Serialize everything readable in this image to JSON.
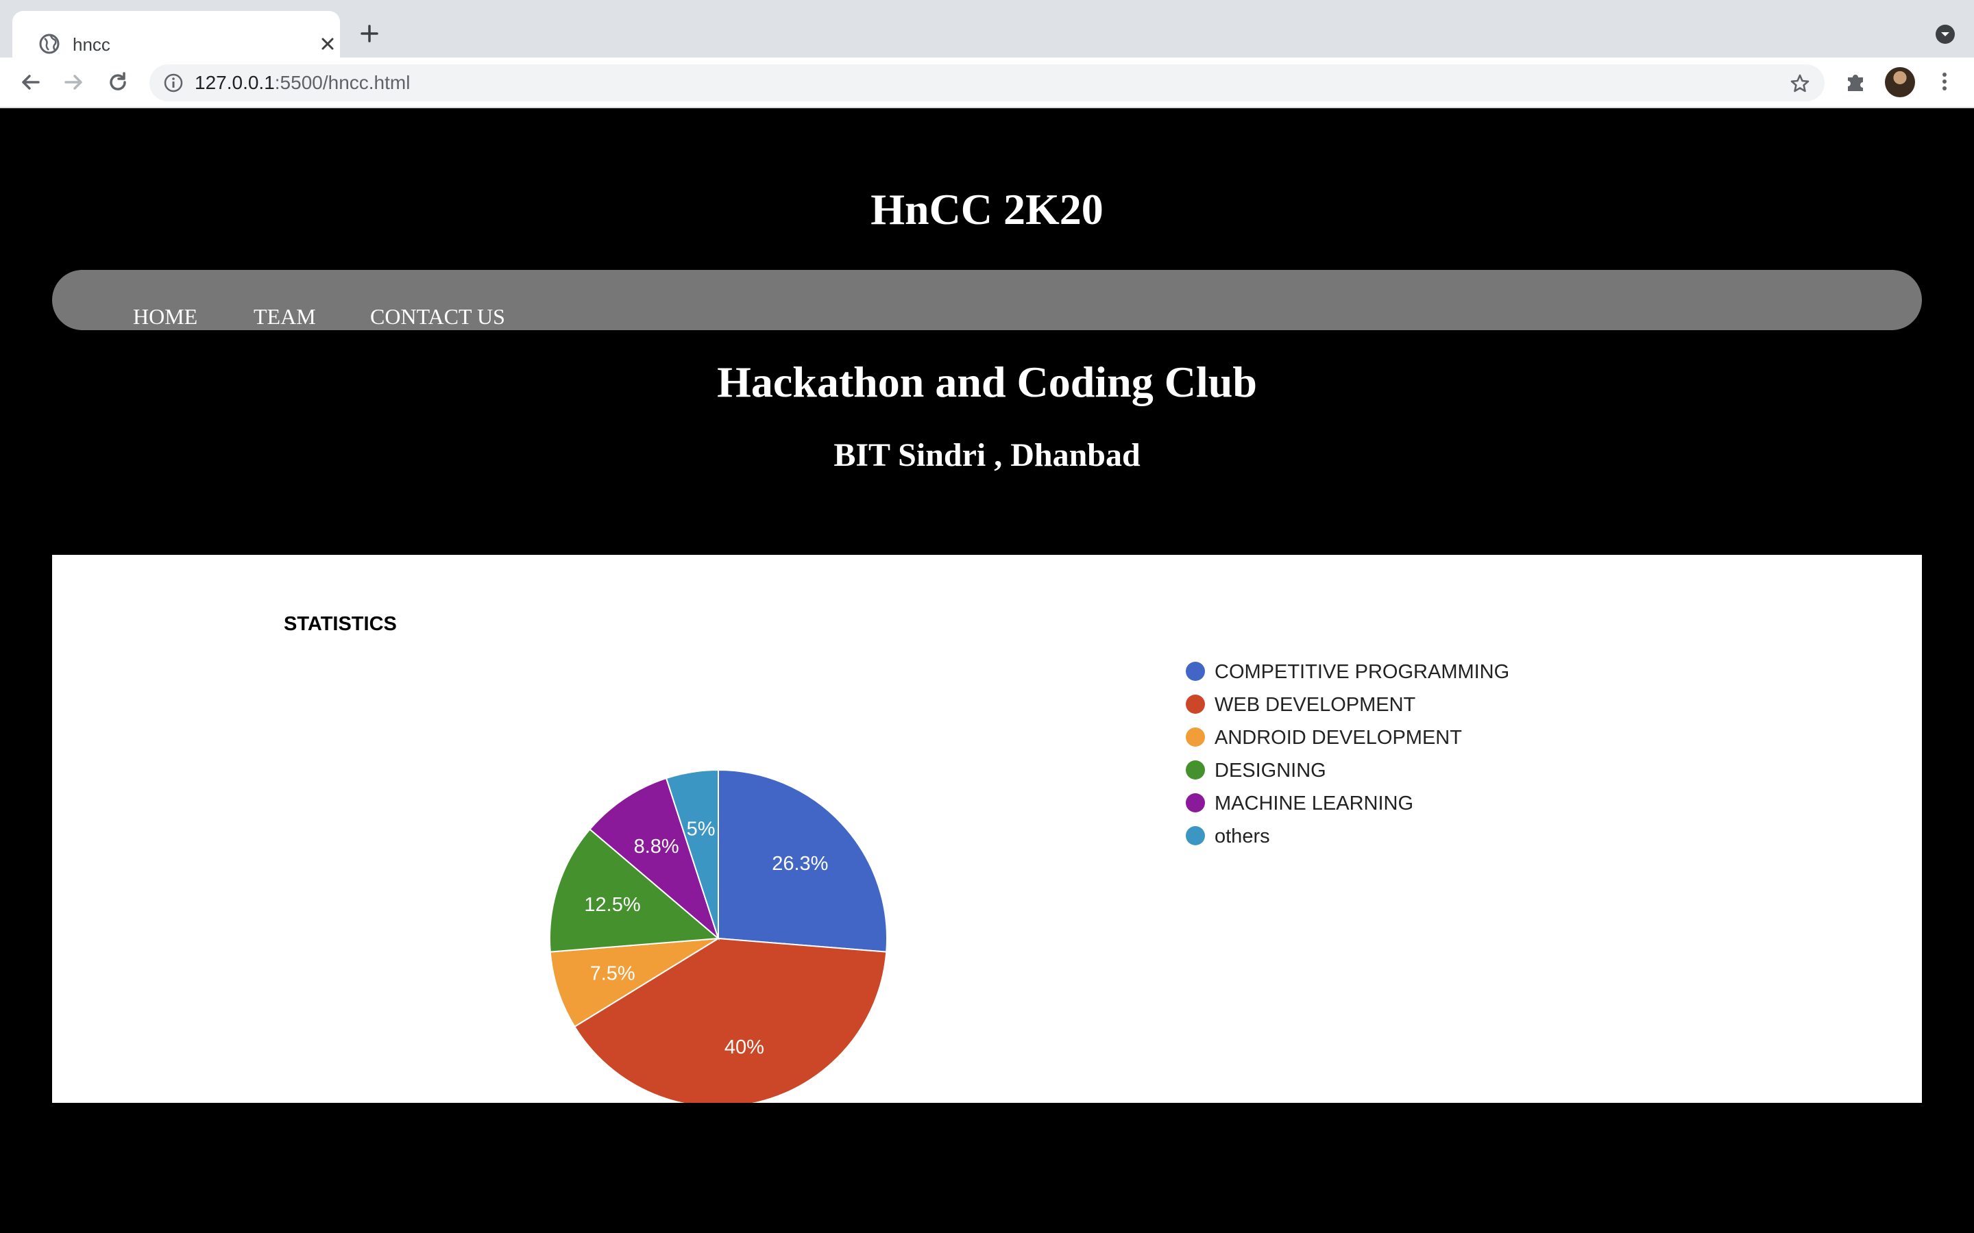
{
  "browser": {
    "tab_title": "hncc",
    "url_host": "127.0.0.1",
    "url_rest": ":5500/hncc.html"
  },
  "site": {
    "title": "HnCC 2K20",
    "nav": [
      "HOME",
      "TEAM",
      "CONTACT US"
    ],
    "headline": "Hackathon and Coding Club",
    "subheadline": "BIT Sindri , Dhanbad"
  },
  "chart_data": {
    "type": "pie",
    "title": "STATISTICS",
    "legend_position": "right",
    "categories": [
      "COMPETITIVE PROGRAMMING",
      "WEB DEVELOPMENT",
      "ANDROID DEVELOPMENT",
      "DESIGNING",
      "MACHINE LEARNING",
      "others"
    ],
    "values": [
      26.3,
      40,
      7.5,
      12.5,
      8.8,
      5
    ],
    "labels": [
      "26.3%",
      "40%",
      "7.5%",
      "12.5%",
      "8.8%",
      "5%"
    ],
    "colors": [
      "#4266c5",
      "#cc4727",
      "#f19d38",
      "#45912e",
      "#8a1a99",
      "#3c96c3"
    ]
  }
}
